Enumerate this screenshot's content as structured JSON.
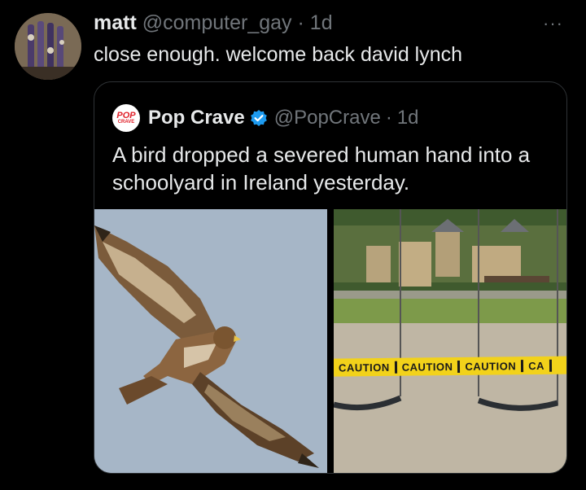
{
  "tweet": {
    "name": "matt",
    "handle": "@computer_gay",
    "separator": "·",
    "time": "1d",
    "more": "···",
    "text": "close enough. welcome back david lynch"
  },
  "quote": {
    "logo_line1": "POP",
    "logo_line2": "CRAVE",
    "name": "Pop Crave",
    "handle": "@PopCrave",
    "separator": "·",
    "time": "1d",
    "text": "A bird dropped a severed human hand into a schoolyard in Ireland yesterday.",
    "tape_text": [
      "CAUTION",
      "CAUTION",
      "CAUTION",
      "CA"
    ]
  },
  "colors": {
    "background": "#000000",
    "text": "#e7e9ea",
    "muted": "#71767b",
    "verified": "#1d9bf0"
  }
}
